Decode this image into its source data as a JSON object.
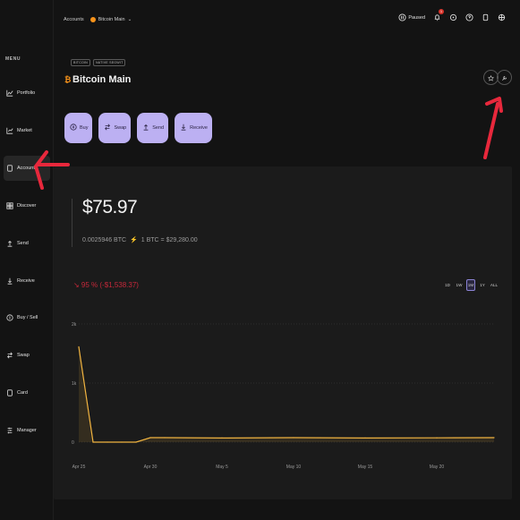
{
  "sidebar": {
    "menu_label": "MENU",
    "items": [
      {
        "label": "Portfolio",
        "icon": "chart-icon"
      },
      {
        "label": "Market",
        "icon": "market-icon"
      },
      {
        "label": "Accounts",
        "icon": "wallet-icon",
        "active": true
      },
      {
        "label": "Discover",
        "icon": "grid-icon"
      },
      {
        "label": "Send",
        "icon": "send-icon"
      },
      {
        "label": "Receive",
        "icon": "receive-icon"
      },
      {
        "label": "Buy / Sell",
        "icon": "exchange-icon"
      },
      {
        "label": "Swap",
        "icon": "swap-icon"
      },
      {
        "label": "Card",
        "icon": "card-icon"
      },
      {
        "label": "Manager",
        "icon": "manager-icon"
      }
    ]
  },
  "topbar": {
    "breadcrumb_root": "Accounts",
    "breadcrumb_current": "Bitcoin Main",
    "paused_label": "Paused",
    "notification_count": "1"
  },
  "account": {
    "tag_currency": "BITCOIN",
    "tag_type": "NATIVE SEGWIT",
    "name": "Bitcoin Main",
    "actions": [
      {
        "label": "Buy",
        "icon": "buy-icon"
      },
      {
        "label": "Swap",
        "icon": "swap-icon"
      },
      {
        "label": "Send",
        "icon": "send-icon"
      },
      {
        "label": "Receive",
        "icon": "receive-icon"
      }
    ]
  },
  "balance": {
    "fiat": "$75.97",
    "crypto": "0.0025946 BTC",
    "rate": "1 BTC = $29,280.00",
    "change": "↘ 95 % (-$1,538.37)"
  },
  "ranges": {
    "options": [
      "1D",
      "1W",
      "1M",
      "1Y",
      "ALL"
    ],
    "selected": "1M"
  },
  "colors": {
    "accent": "#bcb0f2",
    "line": "#f0b340",
    "negative": "#c7283a",
    "bitcoin": "#f7931a",
    "annotation": "#e8283c"
  },
  "chart_data": {
    "type": "area",
    "ylabel": "",
    "xlabel": "",
    "y_ticks": [
      "2k",
      "1k",
      "0"
    ],
    "ylim": [
      0,
      2000
    ],
    "x_ticks": [
      "Apr 25",
      "Apr 30",
      "May 5",
      "May 10",
      "May 15",
      "May 20"
    ],
    "x": [
      "Apr 25",
      "Apr 26",
      "Apr 27",
      "Apr 28",
      "Apr 29",
      "Apr 30",
      "May 1",
      "May 5",
      "May 10",
      "May 15",
      "May 20",
      "May 24"
    ],
    "values": [
      1614,
      0,
      0,
      0,
      0,
      76,
      76,
      70,
      76,
      70,
      72,
      76
    ]
  }
}
